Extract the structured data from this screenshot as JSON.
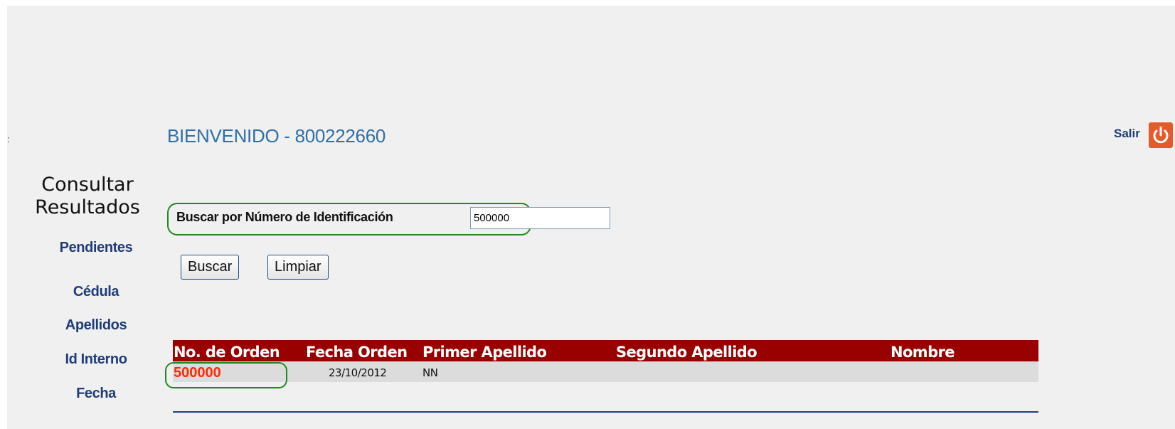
{
  "header": {
    "colon": ":",
    "welcome": "BIENVENIDO - 800222660",
    "logout_label": "Salir",
    "logout_icon": "power-icon",
    "logout_color": "#e55a2b"
  },
  "sidebar": {
    "title_line1": "Consultar",
    "title_line2": "Resultados",
    "items": [
      {
        "label": "Pendientes"
      },
      {
        "label": "Cédula"
      },
      {
        "label": "Apellidos"
      },
      {
        "label": "Id Interno"
      },
      {
        "label": "Fecha"
      }
    ]
  },
  "search": {
    "label": "Buscar por Número de Identificación",
    "value": "500000",
    "buttons": {
      "search": "Buscar",
      "clear": "Limpiar"
    },
    "highlight_color": "#1e8a1e"
  },
  "results": {
    "header_color": "#990000",
    "columns": [
      "No. de Orden",
      "Fecha Orden",
      "Primer Apellido",
      "Segundo Apellido",
      "Nombre"
    ],
    "rows": [
      {
        "order": "500000",
        "date": "23/10/2012",
        "first_surname": "NN",
        "second_surname": "",
        "name": ""
      }
    ]
  }
}
